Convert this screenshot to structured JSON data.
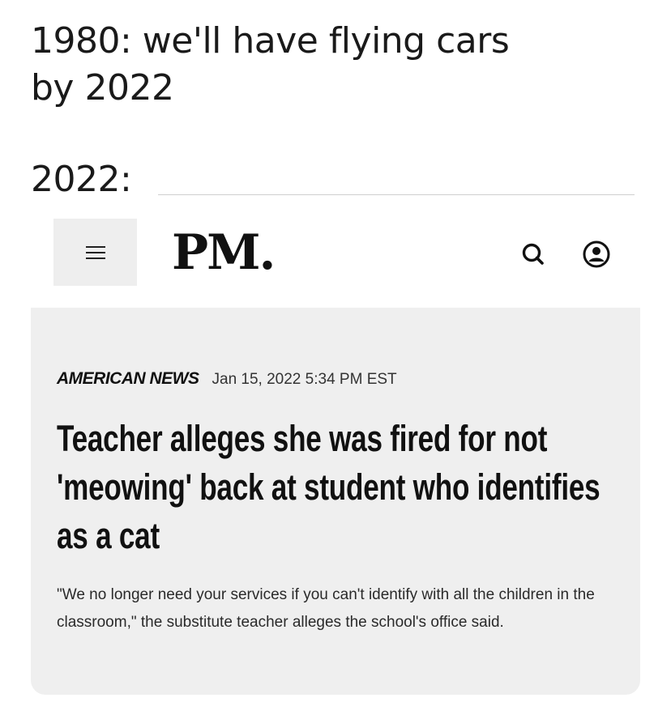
{
  "meme": {
    "caption_top": "1980: we'll have flying cars by 2022",
    "caption_bottom": "2022:"
  },
  "header": {
    "logo": "PM.",
    "menu_icon": "hamburger-menu-icon",
    "search_icon": "search-icon",
    "profile_icon": "user-profile-icon"
  },
  "article": {
    "category": "AMERICAN NEWS",
    "date": "Jan 15, 2022 5:34 PM EST",
    "headline": "Teacher alleges she was fired for not 'meowing' back at student who identifies as a cat",
    "excerpt": "\"We no longer need your services if you can't identify with all the children in the classroom,\" the substitute teacher alleges the school's office said."
  },
  "colors": {
    "card_background": "#efefef",
    "menu_background": "#eeeeee",
    "text": "#111111"
  }
}
